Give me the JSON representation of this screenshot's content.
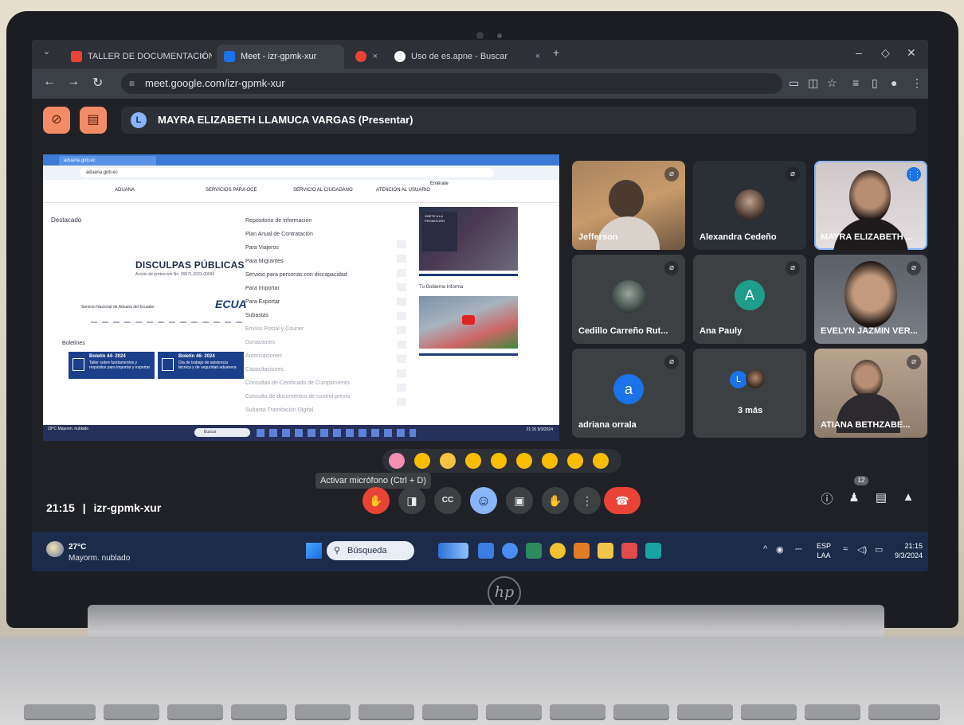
{
  "browser": {
    "tabs": [
      {
        "label": "TALLER DE DOCUMENTACIÓN",
        "close": "×",
        "icon_color": "#ea4335"
      },
      {
        "label": "Meet - izr-gpmk-xur",
        "close": "×",
        "icon_color": "#1a73e8"
      },
      {
        "label": "",
        "close": "×",
        "icon_color": "#ea4335"
      },
      {
        "label": "Uso de es.apne - Buscar",
        "close": "×",
        "icon_color": "#ffffff"
      }
    ],
    "new_tab": "+",
    "url": "meet.google.com/izr-gpmk-xur",
    "window_controls": {
      "minimize": "–",
      "restore": "◇",
      "close": "✕"
    }
  },
  "meet": {
    "presenter_initial": "L",
    "presenter_banner": "MAYRA ELIZABETH LLAMUCA VARGAS (Presentar)",
    "shared_screen": {
      "tab_label": "aduana.gob.ec",
      "url": "aduana.gob.ec",
      "nav": [
        "ADUANA",
        "SERVICIOS PARA OCE",
        "SERVICIO AL CIUDADANO",
        "ATENCIÓN AL USUARIO",
        "Entérate"
      ],
      "side_label": "Destacado",
      "headline": "DISCULPAS PÚBLICAS",
      "headline_sub": "Acción de protección No. 09571-2023-00090",
      "org_line": "Servicio Nacional de Aduana del Ecuador",
      "logo_text": "ECUA",
      "boletines_label": "Boletines",
      "cards": [
        {
          "title": "Boletín 44- 2024",
          "body": "Taller sobre fundamentos y requisitos para importar y exportar"
        },
        {
          "title": "Boletín 46- 2024",
          "body": "Día de trabajo de asistencia técnica y de seguridad aduanera"
        }
      ],
      "menu": [
        "Repositorio de información",
        "Plan Anual de Contratación",
        "Para Viajeros",
        "Para Migrantes",
        "Servicio para personas con discapacidad",
        "Para Importar",
        "Para Exportar",
        "Subastas",
        "Envíos Postal y Courier",
        "Donaciones",
        "Autorizaciones",
        "Capacitaciones",
        "Consultas de Certificado de Cumplimiento",
        "Consulta de documentos de control previo",
        "Subasta Tramitación Digital"
      ],
      "image_badge": "ÚNETE A LA PROMOCIÓN",
      "gobierno": "Tu Gobierno Informa",
      "taskbar_weather": "29°C Mayorm. nublado",
      "taskbar_search": "Buscar",
      "taskbar_clock": "21:15 9/3/2024"
    },
    "participants": [
      {
        "name": "Jefferson",
        "state": "muted"
      },
      {
        "name": "Alexandra Cedeño",
        "state": "muted"
      },
      {
        "name": "MAYRA ELIZABETH ...",
        "state": "speaking"
      },
      {
        "name": "Cedillo Carreño Rut...",
        "state": "muted"
      },
      {
        "name": "Ana Pauly",
        "initial": "A",
        "state": "muted"
      },
      {
        "name": "EVELYN JAZMIN VER...",
        "state": "muted"
      },
      {
        "name": "adriana orrala",
        "initial": "a",
        "state": "muted"
      },
      {
        "name": "3 más",
        "initial": "L",
        "state": "group"
      },
      {
        "name": "ATIANA BETHZABE...",
        "state": "muted"
      }
    ],
    "reactions": [
      "pink-heart",
      "thumbs-up",
      "party-popper",
      "clapping-hands",
      "tears-of-joy",
      "surprised-face",
      "crying-face",
      "thinking-face",
      "thumbs-down"
    ],
    "tooltip": "Activar micrófono (Ctrl + D)",
    "time": "21:15",
    "separator": "|",
    "meeting_code": "izr-gpmk-xur",
    "controls": {
      "mic": "mic-off-icon",
      "camera": "camera-icon",
      "captions": "CC",
      "emoji": "☺",
      "present": "present-icon",
      "hand": "hand-icon",
      "more": "⋮",
      "end": "end-call-icon"
    },
    "people_count": "12"
  },
  "taskbar": {
    "temperature": "27°C",
    "condition": "Mayorm. nublado",
    "search": "Búsqueda",
    "lang_1": "ESP",
    "lang_2": "LAA",
    "time": "21:15",
    "date": "9/3/2024"
  },
  "device": {
    "brand": "hp"
  },
  "colors": {
    "meet_bg": "#1f2126",
    "tile_bg": "#3c4043",
    "accent_blue": "#8ab4f8",
    "end_red": "#ea4335",
    "banner_orange": "#f28b66"
  }
}
